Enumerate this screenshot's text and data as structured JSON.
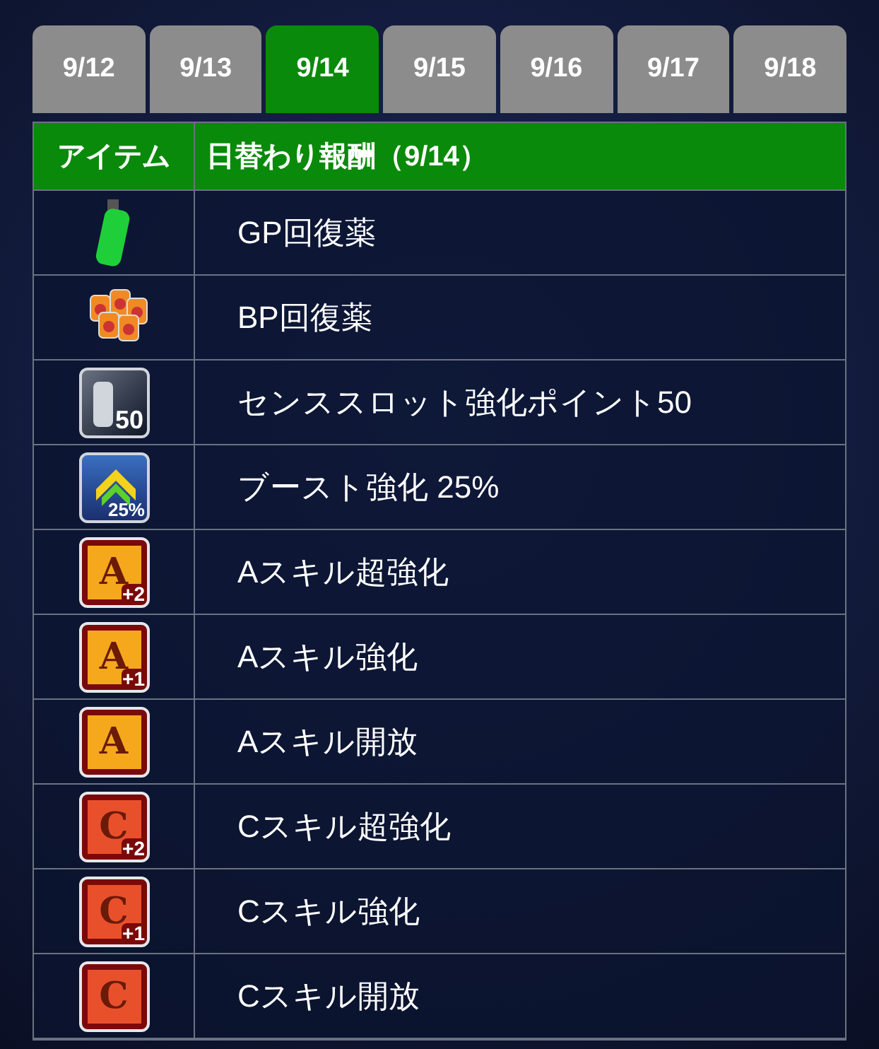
{
  "tabs": [
    {
      "label": "9/12",
      "selected": false
    },
    {
      "label": "9/13",
      "selected": false
    },
    {
      "label": "9/14",
      "selected": true
    },
    {
      "label": "9/15",
      "selected": false
    },
    {
      "label": "9/16",
      "selected": false
    },
    {
      "label": "9/17",
      "selected": false
    },
    {
      "label": "9/18",
      "selected": false
    }
  ],
  "table": {
    "columns": [
      "アイテム",
      "日替わり報酬（9/14）"
    ],
    "rows": [
      {
        "icon": {
          "kind": "bottle"
        },
        "name": "GP回復薬"
      },
      {
        "icon": {
          "kind": "pouches"
        },
        "name": "BP回復薬"
      },
      {
        "icon": {
          "kind": "card",
          "badge": "50"
        },
        "name": "センススロット強化ポイント50"
      },
      {
        "icon": {
          "kind": "boost",
          "badge": "25%"
        },
        "name": "ブースト強化 25%"
      },
      {
        "icon": {
          "kind": "skill",
          "letter": "A",
          "badge": "+2",
          "color": "#f5a81c"
        },
        "name": "Aスキル超強化"
      },
      {
        "icon": {
          "kind": "skill",
          "letter": "A",
          "badge": "+1",
          "color": "#f5a81c"
        },
        "name": "Aスキル強化"
      },
      {
        "icon": {
          "kind": "skill",
          "letter": "A",
          "color": "#f5a81c"
        },
        "name": "Aスキル開放"
      },
      {
        "icon": {
          "kind": "skill",
          "letter": "C",
          "badge": "+2",
          "color": "#e8502c"
        },
        "name": "Cスキル超強化"
      },
      {
        "icon": {
          "kind": "skill",
          "letter": "C",
          "badge": "+1",
          "color": "#e8502c"
        },
        "name": "Cスキル強化"
      },
      {
        "icon": {
          "kind": "skill",
          "letter": "C",
          "color": "#e8502c"
        },
        "name": "Cスキル開放"
      }
    ]
  }
}
